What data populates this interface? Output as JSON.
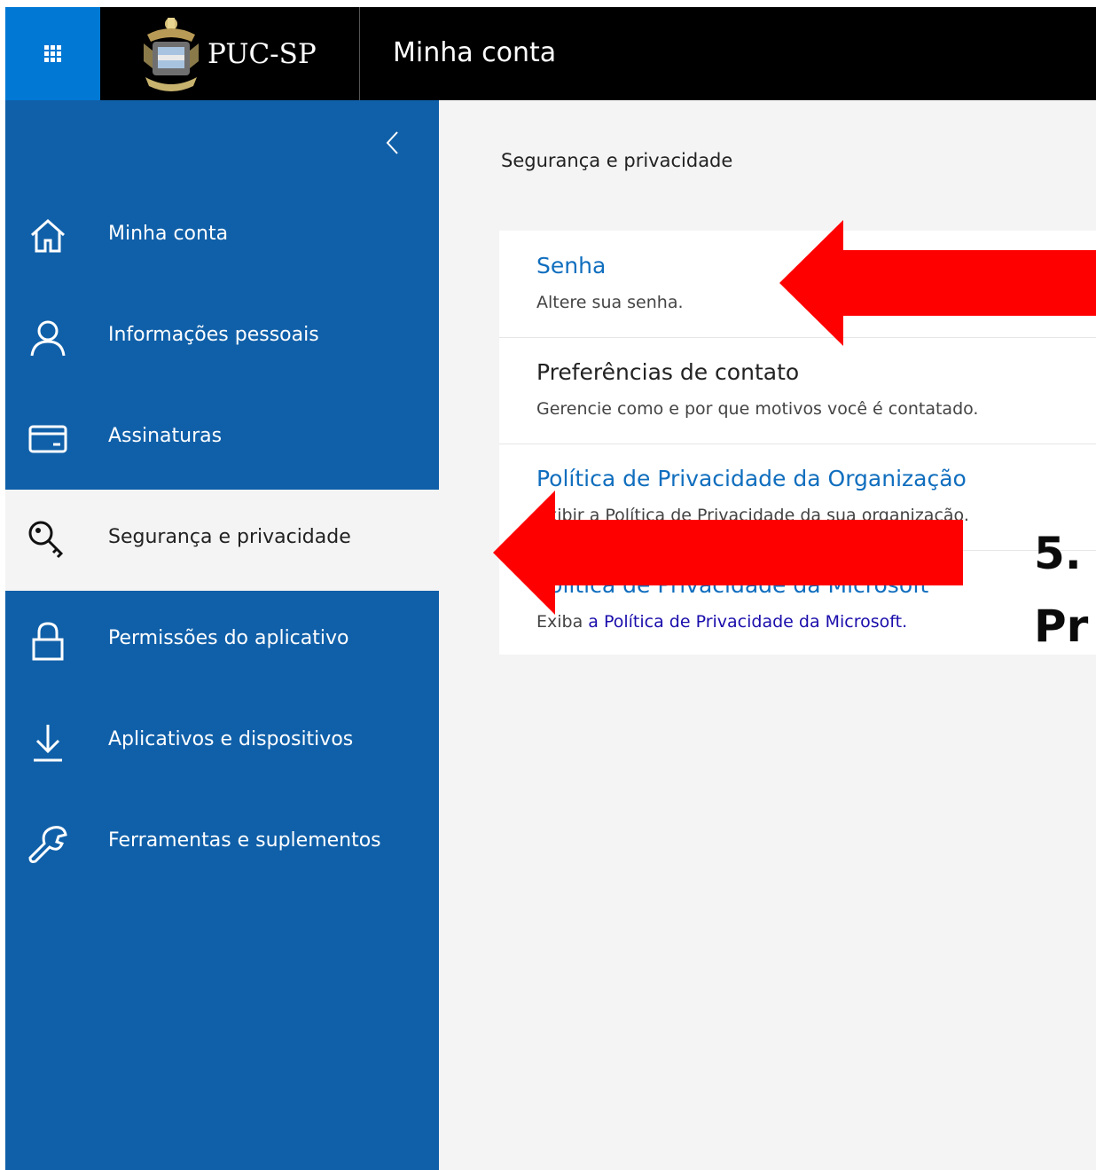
{
  "header": {
    "logo_text": "PUC-SP",
    "title": "Minha conta"
  },
  "sidebar": {
    "items": [
      {
        "label": "Minha conta",
        "icon": "home-icon"
      },
      {
        "label": "Informações pessoais",
        "icon": "person-icon"
      },
      {
        "label": "Assinaturas",
        "icon": "card-icon"
      },
      {
        "label": "Segurança e privacidade",
        "icon": "key-icon",
        "active": true
      },
      {
        "label": "Permissões do aplicativo",
        "icon": "lock-icon"
      },
      {
        "label": "Aplicativos e dispositivos",
        "icon": "download-icon"
      },
      {
        "label": "Ferramentas e suplementos",
        "icon": "wrench-icon"
      }
    ]
  },
  "main": {
    "breadcrumb": "Segurança e privacidade",
    "rows": [
      {
        "title": "Senha",
        "desc": "Altere sua senha."
      },
      {
        "title": "Preferências de contato",
        "desc": "Gerencie como e por que motivos você é contatado."
      },
      {
        "title": "Política de Privacidade da Organização",
        "desc": "Exibir a Política de Privacidade da sua organização."
      },
      {
        "title": "Política de Privacidade da Microsoft",
        "desc_prefix": "Exiba ",
        "desc_link": "a Política de Privacidade da Microsoft."
      }
    ]
  },
  "annotation": {
    "line1": "5.",
    "line2": "Pr",
    "arrow_color": "#ff0000"
  },
  "colors": {
    "sidebar": "#1060a9",
    "waffle": "#0078d4",
    "topbar": "#000000",
    "link": "#106ebe"
  }
}
